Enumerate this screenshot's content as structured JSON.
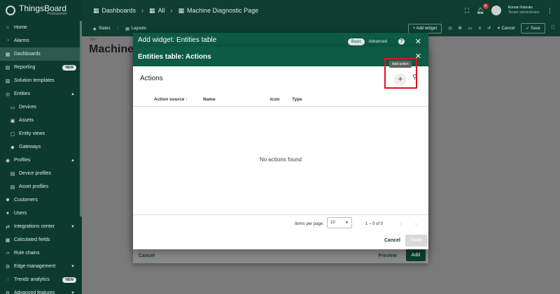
{
  "brand": {
    "name": "ThingsBoard",
    "sub": "Professional"
  },
  "sidebar": {
    "items": [
      {
        "label": "Home",
        "icon": "home-icon"
      },
      {
        "label": "Alarms",
        "icon": "bell-icon"
      },
      {
        "label": "Dashboards",
        "icon": "grid-icon",
        "active": true
      },
      {
        "label": "Reporting",
        "icon": "report-icon",
        "badge": "NEW"
      },
      {
        "label": "Solution templates",
        "icon": "template-icon"
      },
      {
        "label": "Entities",
        "icon": "entities-icon",
        "chevron": "▲"
      },
      {
        "label": "Devices",
        "icon": "device-icon",
        "sub": true
      },
      {
        "label": "Assets",
        "icon": "asset-icon",
        "sub": true
      },
      {
        "label": "Entity views",
        "icon": "view-icon",
        "sub": true
      },
      {
        "label": "Gateways",
        "icon": "gateway-icon",
        "sub": true
      },
      {
        "label": "Profiles",
        "icon": "profiles-icon",
        "chevron": "▲"
      },
      {
        "label": "Device profiles",
        "icon": "device-profile-icon",
        "sub": true
      },
      {
        "label": "Asset profiles",
        "icon": "asset-profile-icon",
        "sub": true
      },
      {
        "label": "Customers",
        "icon": "customers-icon"
      },
      {
        "label": "Users",
        "icon": "users-icon"
      },
      {
        "label": "Integrations center",
        "icon": "integrations-icon",
        "chevron": "▼"
      },
      {
        "label": "Calculated fields",
        "icon": "calc-icon"
      },
      {
        "label": "Rule chains",
        "icon": "rule-icon"
      },
      {
        "label": "Edge management",
        "icon": "edge-icon",
        "chevron": "▼"
      },
      {
        "label": "Trendz analytics",
        "icon": "trendz-icon",
        "badge": "NEW"
      },
      {
        "label": "Advanced features",
        "icon": "advanced-icon",
        "chevron": "▼"
      }
    ]
  },
  "topbar": {
    "crumbs": [
      "Dashboards",
      "All",
      "Machine Diagnostic Page"
    ],
    "notif_count": "8",
    "user_name": "Roman Kolesko",
    "user_role": "Tenant administrator"
  },
  "toolbar": {
    "states": "States",
    "layouts": "Layouts",
    "add_widget": "+ Add widget",
    "cancel": "Cancel",
    "save": "Save"
  },
  "page": {
    "title_label": "Title*",
    "title": "Machine"
  },
  "outer_dialog": {
    "title": "Add widget: Entities table",
    "mode_basic": "Basic",
    "mode_advanced": "Advanced",
    "cancel": "Cancel",
    "preview": "Preview",
    "add": "Add"
  },
  "inner_dialog": {
    "title": "Entities table: Actions",
    "subtitle": "Actions",
    "tooltip": "Add action",
    "columns": [
      "Action source ↑",
      "Name",
      "Icon",
      "Type"
    ],
    "empty": "No actions found",
    "pager": {
      "label": "Items per page:",
      "value": "10",
      "range": "1 – 0 of 0"
    },
    "cancel": "Cancel",
    "save": "Save"
  }
}
